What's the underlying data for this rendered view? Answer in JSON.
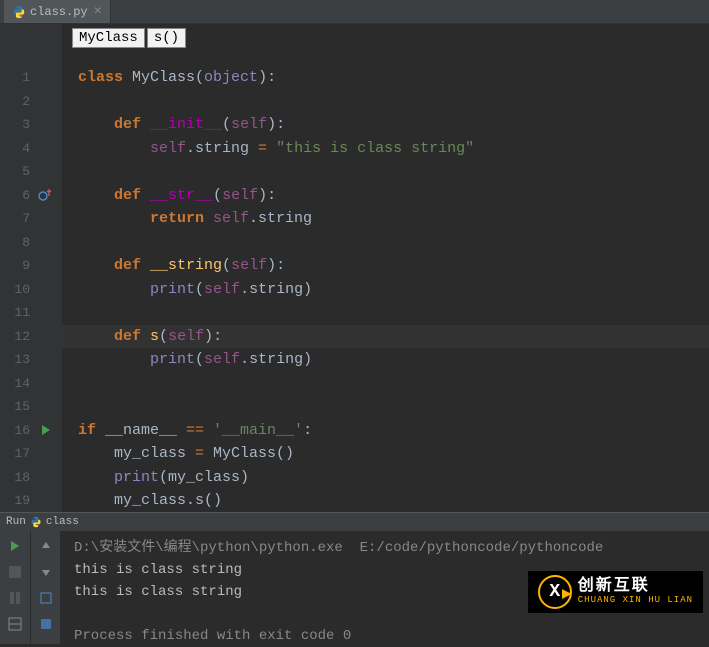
{
  "tab": {
    "filename": "class.py"
  },
  "breadcrumb": {
    "class": "MyClass",
    "method": "s()"
  },
  "lines": {
    "count": 19,
    "override_line": 6,
    "run_marker_line": 16,
    "current_line": 12
  },
  "code": {
    "l1_class": "class ",
    "l1_name": "MyClass",
    "l1_paren_open": "(",
    "l1_object": "object",
    "l1_paren_close": "):",
    "l3_def": "def ",
    "l3_name": "__init__",
    "l3_sig_open": "(",
    "l3_self": "self",
    "l3_sig_close": "):",
    "l4_self": "self",
    "l4_dot_attr": ".string ",
    "l4_eq": "= ",
    "l4_str": "\"this is class string\"",
    "l6_def": "def ",
    "l6_name": "__str__",
    "l6_sig_open": "(",
    "l6_self": "self",
    "l6_sig_close": "):",
    "l7_return": "return ",
    "l7_self": "self",
    "l7_attr": ".string",
    "l9_def": "def ",
    "l9_name": "__string",
    "l9_sig_open": "(",
    "l9_self": "self",
    "l9_sig_close": "):",
    "l10_print": "print",
    "l10_open": "(",
    "l10_self": "self",
    "l10_attr": ".string",
    "l10_close": ")",
    "l12_def": "def ",
    "l12_name": "s",
    "l12_sig_open": "(",
    "l12_self": "self",
    "l12_sig_close": "):",
    "l13_print": "print",
    "l13_open": "(",
    "l13_self": "self",
    "l13_attr": ".string",
    "l13_close": ")",
    "l16_if": "if ",
    "l16_name": "__name__ ",
    "l16_eq": "== ",
    "l16_str": "'__main__'",
    "l16_colon": ":",
    "l17_var": "my_class ",
    "l17_eq": "= ",
    "l17_call": "MyClass()",
    "l18_print": "print",
    "l18_arg": "(my_class)",
    "l19_call": "my_class.s()"
  },
  "run": {
    "label": "Run",
    "config": "class",
    "cmd": "D:\\安装文件\\编程\\python\\python.exe  E:/code/pythoncode/pythoncode",
    "out1": "this is class string",
    "out2": "this is class string",
    "exit": "Process finished with exit code 0"
  },
  "watermark": {
    "cn": "创新互联",
    "en": "CHUANG XIN HU LIAN"
  },
  "colors": {
    "bg": "#2b2b2b",
    "gutter": "#313335",
    "chrome": "#3c3f41",
    "keyword": "#cc7832",
    "string": "#6a8759",
    "self": "#94558d",
    "builtin": "#8888c6",
    "function": "#ffc66d",
    "dunder": "#b200b2"
  }
}
